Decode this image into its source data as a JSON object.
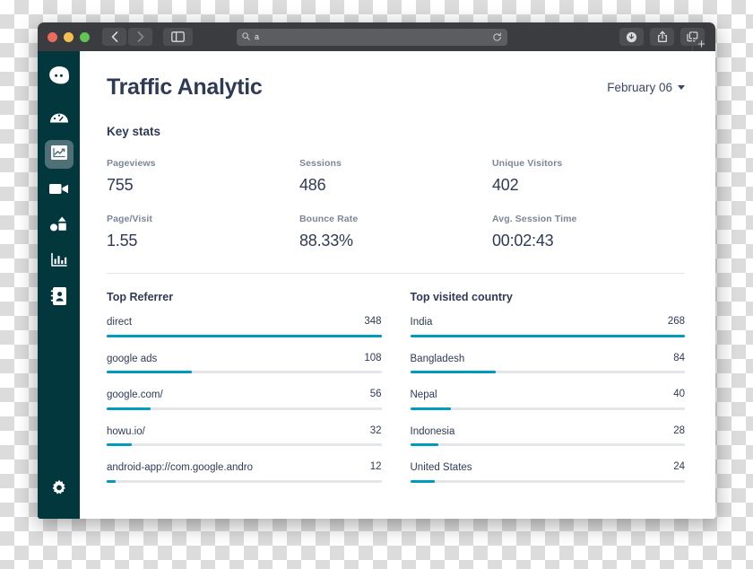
{
  "browser": {
    "address_value": "a",
    "search_icon": "search-icon",
    "reload_icon": "reload-icon",
    "back_icon": "chevron-left-icon",
    "forward_icon": "chevron-right-icon",
    "sidebar_toggle_icon": "sidebar-toggle-icon",
    "download_icon": "download-icon",
    "share_icon": "share-icon",
    "tabs_icon": "tab-overview-icon",
    "new_tab_label": "+"
  },
  "sidebar": {
    "items": [
      {
        "name": "logo",
        "icon": "face-logo-icon",
        "active": false
      },
      {
        "name": "dashboard",
        "icon": "speedometer-icon",
        "active": false
      },
      {
        "name": "analytics",
        "icon": "line-chart-icon",
        "active": true
      },
      {
        "name": "video",
        "icon": "video-camera-icon",
        "active": false
      },
      {
        "name": "shapes",
        "icon": "shapes-icon",
        "active": false
      },
      {
        "name": "reports",
        "icon": "bar-chart-icon",
        "active": false
      },
      {
        "name": "contacts",
        "icon": "contact-book-icon",
        "active": false
      }
    ],
    "bottom": {
      "name": "settings",
      "icon": "gear-icon"
    }
  },
  "header": {
    "title": "Traffic Analytic",
    "date_label": "February 06"
  },
  "key_stats": {
    "heading": "Key stats",
    "items": [
      {
        "label": "Pageviews",
        "value": "755"
      },
      {
        "label": "Sessions",
        "value": "486"
      },
      {
        "label": "Unique Visitors",
        "value": "402"
      },
      {
        "label": "Page/Visit",
        "value": "1.55"
      },
      {
        "label": "Bounce Rate",
        "value": "88.33%"
      },
      {
        "label": "Avg. Session Time",
        "value": "00:02:43"
      }
    ]
  },
  "top_referrer": {
    "title": "Top Referrer",
    "rows": [
      {
        "label": "direct",
        "value": "348",
        "pct": 100
      },
      {
        "label": "google ads",
        "value": "108",
        "pct": 31
      },
      {
        "label": "google.com/",
        "value": "56",
        "pct": 16
      },
      {
        "label": "howu.io/",
        "value": "32",
        "pct": 9.2
      },
      {
        "label": "android-app://com.google.andro",
        "value": "12",
        "pct": 3.4
      }
    ]
  },
  "top_country": {
    "title": "Top visited country",
    "rows": [
      {
        "label": "India",
        "value": "268",
        "pct": 100
      },
      {
        "label": "Bangladesh",
        "value": "84",
        "pct": 31.3
      },
      {
        "label": "Nepal",
        "value": "40",
        "pct": 14.9
      },
      {
        "label": "Indonesia",
        "value": "28",
        "pct": 10.4
      },
      {
        "label": "United States",
        "value": "24",
        "pct": 9
      }
    ]
  },
  "colors": {
    "accent": "#009cbd",
    "sidebar": "#03373e",
    "text_dark": "#2e3a56",
    "track": "#e4e6ea"
  }
}
